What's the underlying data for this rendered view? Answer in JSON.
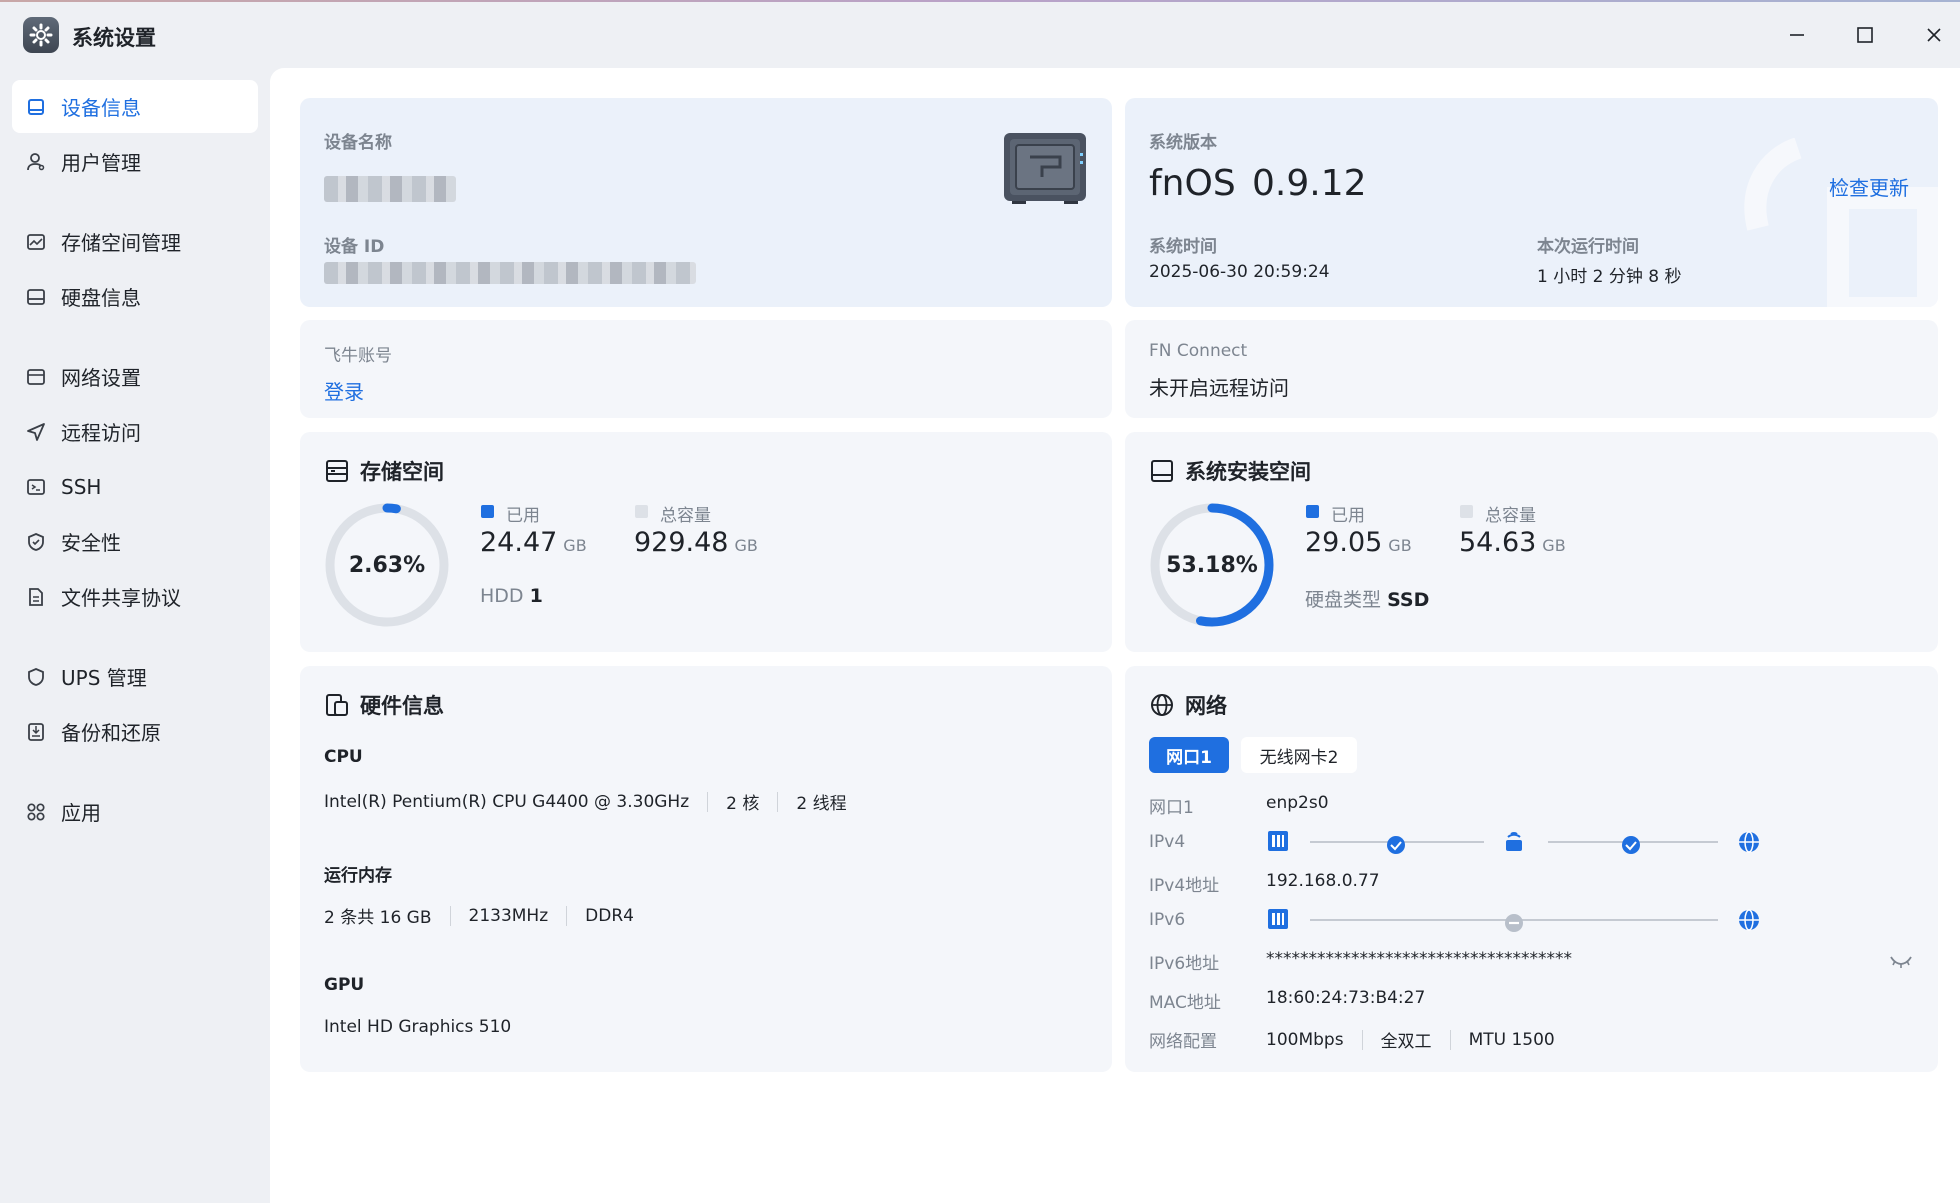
{
  "window": {
    "title": "系统设置"
  },
  "sidebar": {
    "items": [
      {
        "label": "设备信息",
        "icon": "device-icon",
        "active": true
      },
      {
        "label": "用户管理",
        "icon": "user-icon"
      },
      {
        "label": "存储空间管理",
        "icon": "storage-icon"
      },
      {
        "label": "硬盘信息",
        "icon": "disk-icon"
      },
      {
        "label": "网络设置",
        "icon": "network-icon"
      },
      {
        "label": "远程访问",
        "icon": "remote-icon"
      },
      {
        "label": "SSH",
        "icon": "ssh-icon"
      },
      {
        "label": "安全性",
        "icon": "shield-icon"
      },
      {
        "label": "文件共享协议",
        "icon": "file-share-icon"
      },
      {
        "label": "UPS 管理",
        "icon": "ups-icon"
      },
      {
        "label": "备份和还原",
        "icon": "backup-icon"
      },
      {
        "label": "应用",
        "icon": "apps-icon"
      }
    ]
  },
  "device": {
    "name_label": "设备名称",
    "id_label": "设备 ID"
  },
  "system": {
    "version_label": "系统版本",
    "os_name": "fnOS",
    "os_version": "0.9.12",
    "check_update": "检查更新",
    "time_label": "系统时间",
    "time_value": "2025-06-30 20:59:24",
    "uptime_label": "本次运行时间",
    "uptime_value": "1 小时 2 分钟 8 秒"
  },
  "account": {
    "label": "飞牛账号",
    "login": "登录"
  },
  "connect": {
    "label": "FN Connect",
    "value": "未开启远程访问"
  },
  "storage": {
    "title": "存储空间",
    "percent_text": "2.63%",
    "percent": 2.63,
    "used_label": "已用",
    "used_value": "24.47",
    "used_unit": "GB",
    "total_label": "总容量",
    "total_value": "929.48",
    "total_unit": "GB",
    "disk_type": "HDD",
    "disk_count": "1"
  },
  "sys_space": {
    "title": "系统安装空间",
    "percent_text": "53.18%",
    "percent": 53.18,
    "used_label": "已用",
    "used_value": "29.05",
    "used_unit": "GB",
    "total_label": "总容量",
    "total_value": "54.63",
    "total_unit": "GB",
    "disk_type_label": "硬盘类型",
    "disk_type_value": "SSD"
  },
  "hardware": {
    "title": "硬件信息",
    "cpu_label": "CPU",
    "cpu_model": "Intel(R) Pentium(R) CPU G4400 @ 3.30GHz",
    "cpu_cores": "2 核",
    "cpu_threads": "2 线程",
    "mem_label": "运行内存",
    "mem_size": "2 条共 16 GB",
    "mem_speed": "2133MHz",
    "mem_type": "DDR4",
    "gpu_label": "GPU",
    "gpu_model": "Intel HD Graphics 510"
  },
  "network": {
    "title": "网络",
    "tabs": [
      "网口1",
      "无线网卡2"
    ],
    "port_label": "网口1",
    "port_value": "enp2s0",
    "ipv4_label": "IPv4",
    "ipv4_addr_label": "IPv4地址",
    "ipv4_addr": "192.168.0.77",
    "ipv6_label": "IPv6",
    "ipv6_addr_label": "IPv6地址",
    "ipv6_addr": "************************************",
    "mac_label": "MAC地址",
    "mac_value": "18:60:24:73:B4:27",
    "config_label": "网络配置",
    "speed": "100Mbps",
    "duplex": "全双工",
    "mtu": "MTU 1500"
  },
  "colors": {
    "accent": "#1f6fe0",
    "ring_track": "#dde1e7",
    "card": "#f4f6fa",
    "card_blue": "#ebf1fa"
  }
}
